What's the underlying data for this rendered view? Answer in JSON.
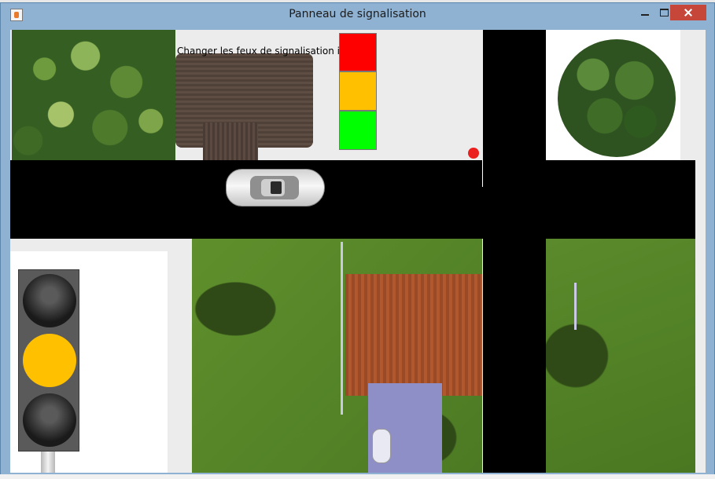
{
  "window": {
    "title": "Panneau de signalisation"
  },
  "panel": {
    "instruction_label": "Changer les feux de signalisation ici -",
    "color_buttons": [
      {
        "name": "red",
        "color": "#ff0000"
      },
      {
        "name": "yellow",
        "color": "#ffc000"
      },
      {
        "name": "green",
        "color": "#00ff00"
      }
    ]
  },
  "traffic_light": {
    "active_light": "yellow",
    "lamp_on_color": "#ffc000"
  },
  "scene": {
    "road_color": "#000000",
    "stop_indicator_color": "#ec1f1f"
  }
}
